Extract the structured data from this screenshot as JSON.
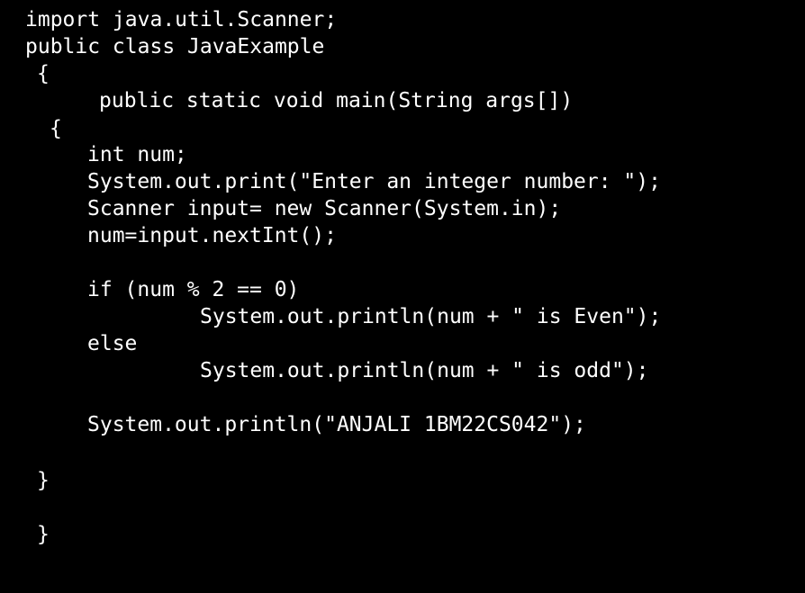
{
  "editor": {
    "text_color": "#ffffff",
    "background_color": "#000000",
    "lines": [
      "import java.util.Scanner;",
      "public class JavaExample",
      "{",
      "public static void main(String args[])",
      "{",
      "int num;",
      "System.out.print(\"Enter an integer number: \");",
      "Scanner input= new Scanner(System.in);",
      "num=input.nextInt();",
      "if (num % 2 == 0)",
      "System.out.println(num + \" is Even\");",
      "else",
      "System.out.println(num + \" is odd\");",
      "System.out.println(\"ANJALI 1BM22CS042\");",
      "}",
      "}"
    ]
  }
}
